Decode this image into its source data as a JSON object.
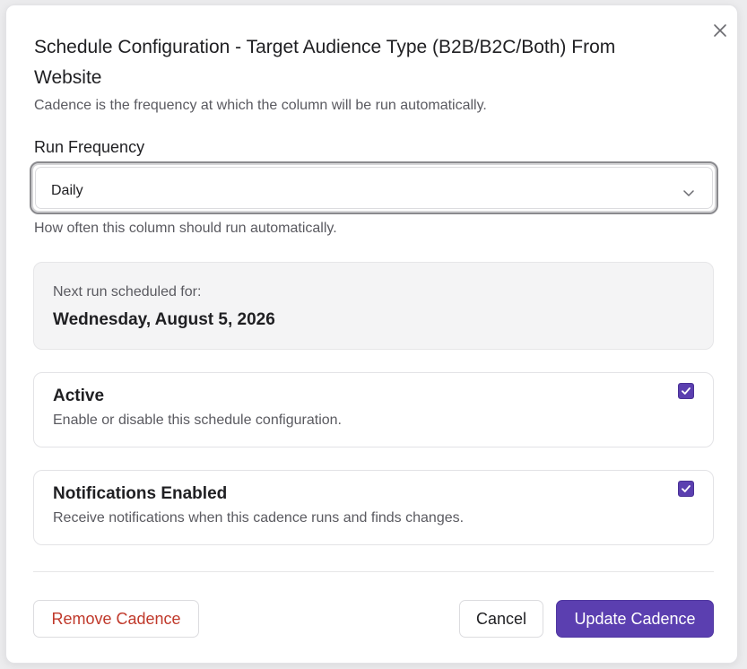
{
  "dialog": {
    "title": "Schedule Configuration - Target Audience Type (B2B/B2C/Both) From Website",
    "subtitle": "Cadence is the frequency at which the column will be run automatically.",
    "close_icon": "close-icon"
  },
  "run_frequency": {
    "label": "Run Frequency",
    "value": "Daily",
    "helper": "How often this column should run automatically.",
    "chevron_icon": "chevron-down-icon"
  },
  "next_run": {
    "label": "Next run scheduled for:",
    "date": "Wednesday, August 5, 2026"
  },
  "options": {
    "active": {
      "title": "Active",
      "description": "Enable or disable this schedule configuration.",
      "checked": true
    },
    "notifications": {
      "title": "Notifications Enabled",
      "description": "Receive notifications when this cadence runs and finds changes.",
      "checked": true
    }
  },
  "footer": {
    "remove_label": "Remove Cadence",
    "cancel_label": "Cancel",
    "update_label": "Update Cadence"
  },
  "colors": {
    "accent": "#5b3fb0",
    "danger": "#c0392b"
  }
}
